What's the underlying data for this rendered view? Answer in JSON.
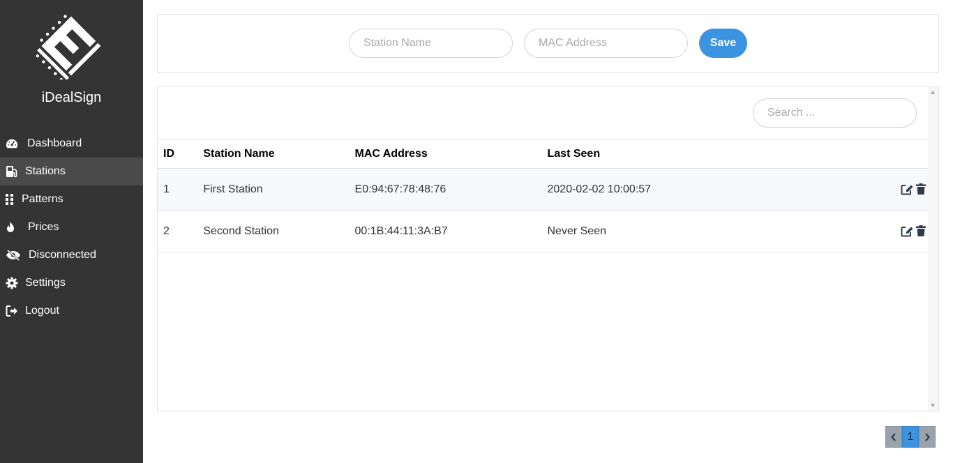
{
  "brand": {
    "name": "iDealSign",
    "logo_icon": "ideal-logo-icon"
  },
  "sidebar": {
    "items": [
      {
        "label": "Dashboard",
        "icon": "tachometer-icon",
        "active": false
      },
      {
        "label": "Stations",
        "icon": "gas-pump-icon",
        "active": true
      },
      {
        "label": "Patterns",
        "icon": "grid-icon",
        "active": false
      },
      {
        "label": "Prices",
        "icon": "flame-icon",
        "active": false
      },
      {
        "label": "Disconnected",
        "icon": "eye-slash-icon",
        "active": false
      },
      {
        "label": "Settings",
        "icon": "gear-icon",
        "active": false
      },
      {
        "label": "Logout",
        "icon": "sign-out-icon",
        "active": false
      }
    ]
  },
  "form": {
    "station_name_placeholder": "Station Name",
    "mac_address_placeholder": "MAC Address",
    "save_label": "Save"
  },
  "table": {
    "search_placeholder": "Search ...",
    "columns": [
      "ID",
      "Station Name",
      "MAC Address",
      "Last Seen"
    ],
    "rows": [
      {
        "id": "1",
        "name": "First Station",
        "mac": "E0:94:67:78:48:76",
        "last_seen": "2020-02-02 10:00:57"
      },
      {
        "id": "2",
        "name": "Second Station",
        "mac": "00:1B:44:11:3A:B7",
        "last_seen": "Never Seen"
      }
    ],
    "row_actions": [
      "edit-icon",
      "trash-icon"
    ]
  },
  "pagination": {
    "current_page": "1",
    "prev_icon": "chevron-left-icon",
    "next_icon": "chevron-right-icon"
  },
  "colors": {
    "sidebar_bg": "#343434",
    "active_item_bg": "#4a4a4a",
    "accent": "#3c93e0",
    "pager_arrow_bg": "#9aa3ad"
  }
}
